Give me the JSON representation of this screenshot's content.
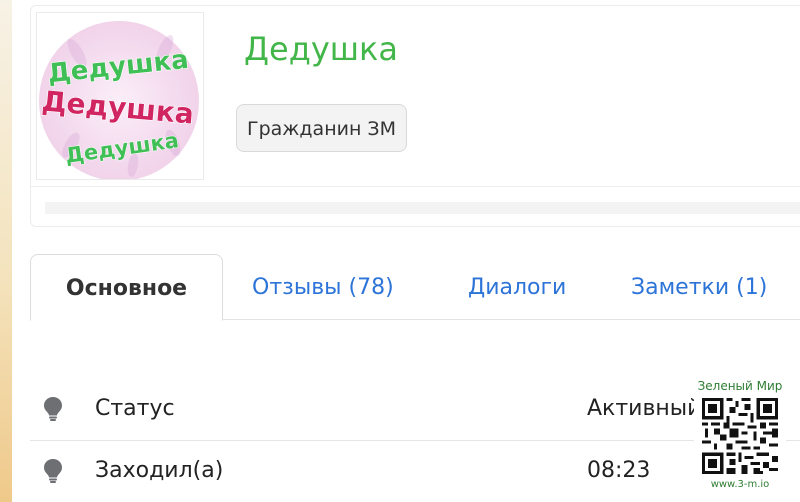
{
  "profile": {
    "username": "Дедушка",
    "rank": "Гражданин ЗМ",
    "avatar": {
      "lines": [
        "Дедушка",
        "Дедушка",
        "Дедушка"
      ],
      "colors": {
        "background": "#f6dff0",
        "top_text": "#3fbf55",
        "middle_text": "#d02560",
        "bottom_text": "#3fbf55"
      }
    },
    "progress": 0
  },
  "tabs": [
    {
      "label": "Основное",
      "active": true
    },
    {
      "label": "Отзывы (78)",
      "active": false
    },
    {
      "label": "Диалоги",
      "active": false
    },
    {
      "label": "Заметки (1)",
      "active": false
    }
  ],
  "info": [
    {
      "icon": "lightbulb-icon",
      "label": "Статус",
      "value": "Активный"
    },
    {
      "icon": "lightbulb-icon",
      "label": "Заходил(а)",
      "value": "08:23"
    }
  ],
  "watermark": {
    "title": "Зеленый Мир",
    "url": "www.3-m.io",
    "color": "#2e7d32"
  },
  "colors": {
    "username": "#43b649",
    "tab_link": "#2d74d8",
    "left_strip_bottom": "#efc98a"
  }
}
